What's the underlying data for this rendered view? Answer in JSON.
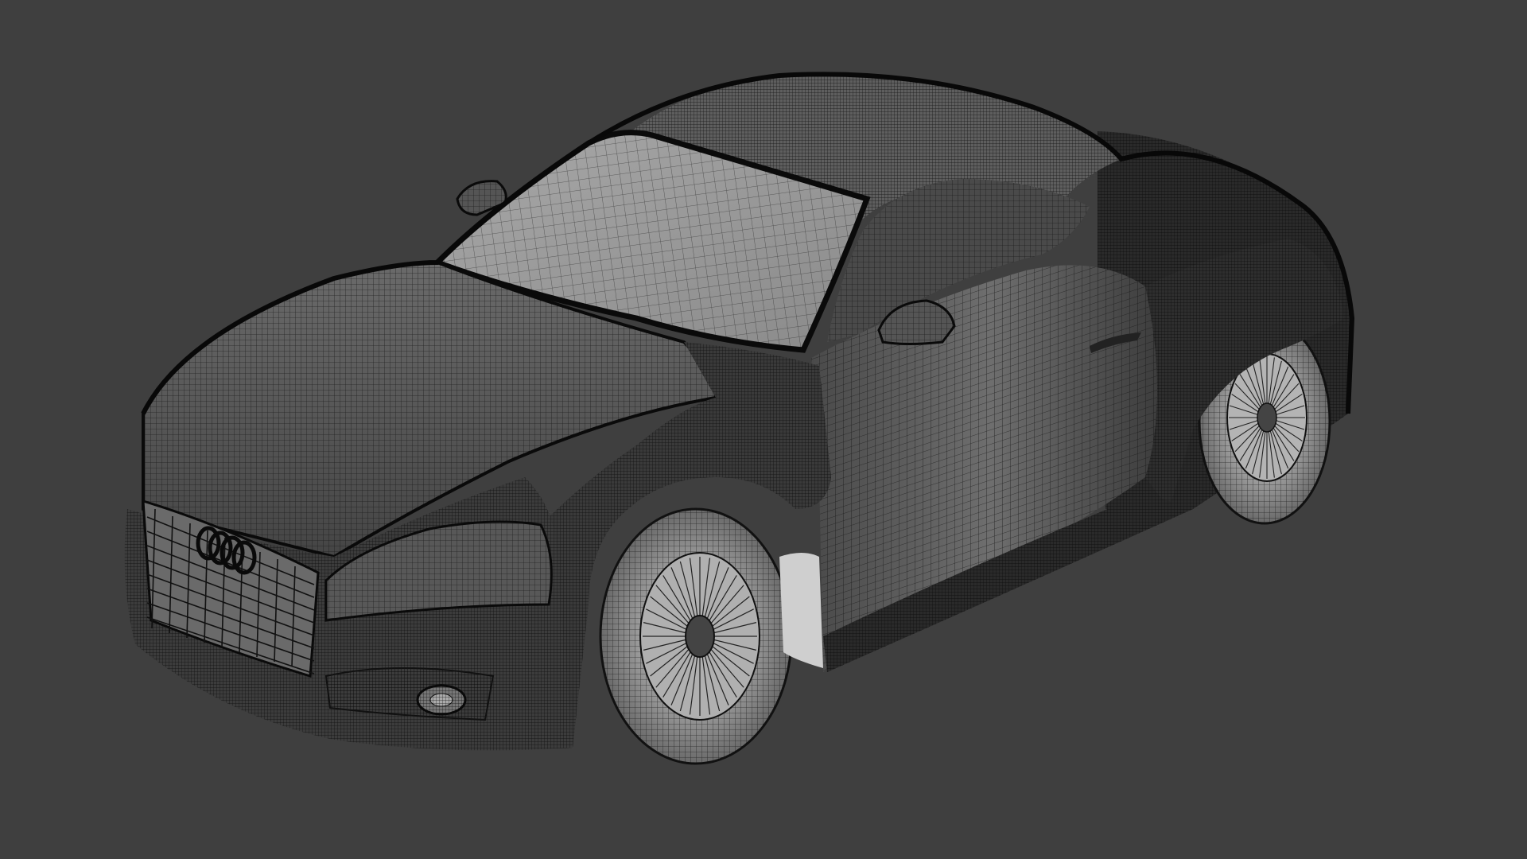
{
  "viewport": {
    "background": "#3f3f3f",
    "display_mode": "wireframe-on-shaded",
    "object": "sports-coupe-mesh"
  },
  "colors": {
    "body_shade": "#5a5a5a",
    "body_dark": "#1e1e1e",
    "glass_shade": "#9a9a9a",
    "wire": "#0a0a0a",
    "tire": "#8c8c8c",
    "rim": "#b0b0b0"
  },
  "emblem": {
    "rings": 4
  }
}
